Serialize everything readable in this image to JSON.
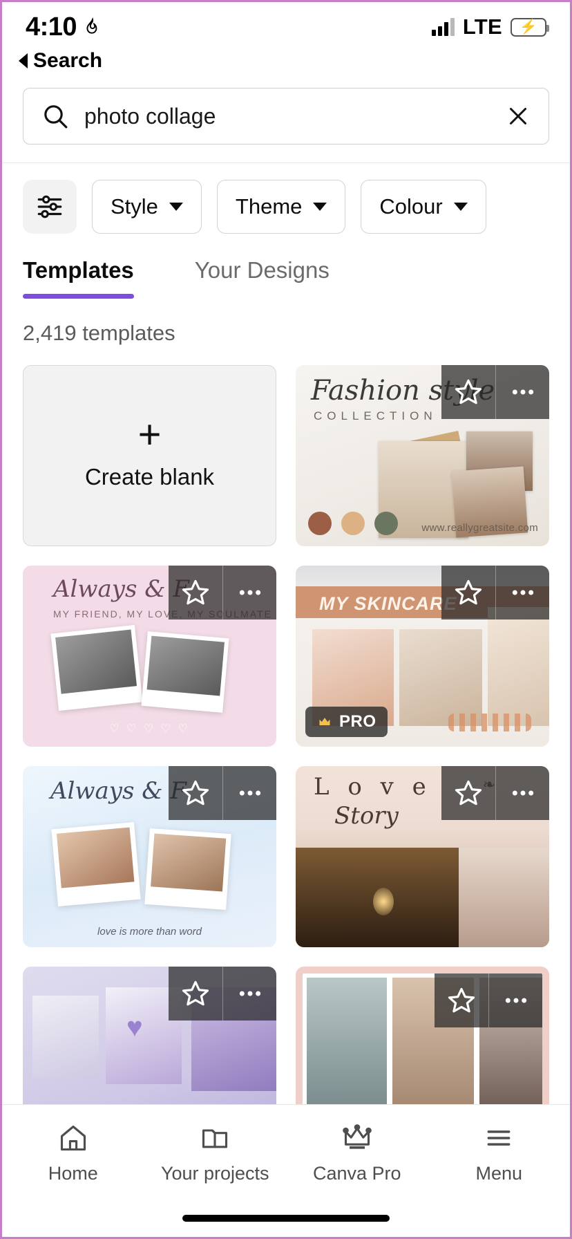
{
  "status_bar": {
    "time": "4:10",
    "alarm_icon": "flame-icon",
    "network": "LTE",
    "signal_icon": "signal-bars-icon",
    "battery_icon": "battery-charging-icon"
  },
  "back": {
    "label": "Search",
    "icon": "back-triangle-icon"
  },
  "search": {
    "value": "photo collage",
    "placeholder": "Search",
    "search_icon": "search-icon",
    "clear_icon": "close-icon"
  },
  "filters": {
    "filter_icon": "sliders-icon",
    "chips": [
      {
        "label": "Style",
        "icon": "chevron-down-icon"
      },
      {
        "label": "Theme",
        "icon": "chevron-down-icon"
      },
      {
        "label": "Colour",
        "icon": "chevron-down-icon"
      }
    ]
  },
  "tabs": [
    {
      "label": "Templates",
      "active": true
    },
    {
      "label": "Your Designs",
      "active": false
    }
  ],
  "results": {
    "count_label": "2,419 templates"
  },
  "create_blank": {
    "label": "Create blank",
    "icon": "plus-icon"
  },
  "card_actions": {
    "favorite_icon": "star-icon",
    "more_icon": "more-horizontal-icon"
  },
  "templates": [
    {
      "name": "fashion-style-collection",
      "title": "Fashion style",
      "subtitle": "COLLECTION",
      "website": "www.reallygreatsite.com",
      "swatches": [
        "#9c5f45",
        "#dcb183",
        "#6b7661"
      ],
      "pro": false
    },
    {
      "name": "always-and-forever-pink",
      "title": "Always & F",
      "subtitle": "MY FRIEND, MY LOVE, MY SOULMATE",
      "hearts": "♡ ♡ ♡ ♡ ♡",
      "pro": false
    },
    {
      "name": "my-skincare",
      "title": "MY SKINCARE",
      "pro": true,
      "pro_label": "PRO",
      "crown_icon": "crown-icon"
    },
    {
      "name": "always-and-forever-blue",
      "title": "Always & F",
      "caption": "love is more than word",
      "pro": false
    },
    {
      "name": "love-story",
      "title": "L o v e",
      "subtitle": "Story",
      "pro": false
    },
    {
      "name": "lavender-collage",
      "pro": false
    },
    {
      "name": "beach-couple-collage",
      "pro": false
    }
  ],
  "bottom_nav": [
    {
      "label": "Home",
      "icon": "home-icon"
    },
    {
      "label": "Your projects",
      "icon": "folder-icon"
    },
    {
      "label": "Canva Pro",
      "icon": "crown-icon"
    },
    {
      "label": "Menu",
      "icon": "hamburger-menu-icon"
    }
  ],
  "colors": {
    "accent": "#7c4dde",
    "chip_border": "#d3d3d3",
    "text_primary": "#0d0d0d",
    "text_secondary": "#5b5b5b"
  }
}
